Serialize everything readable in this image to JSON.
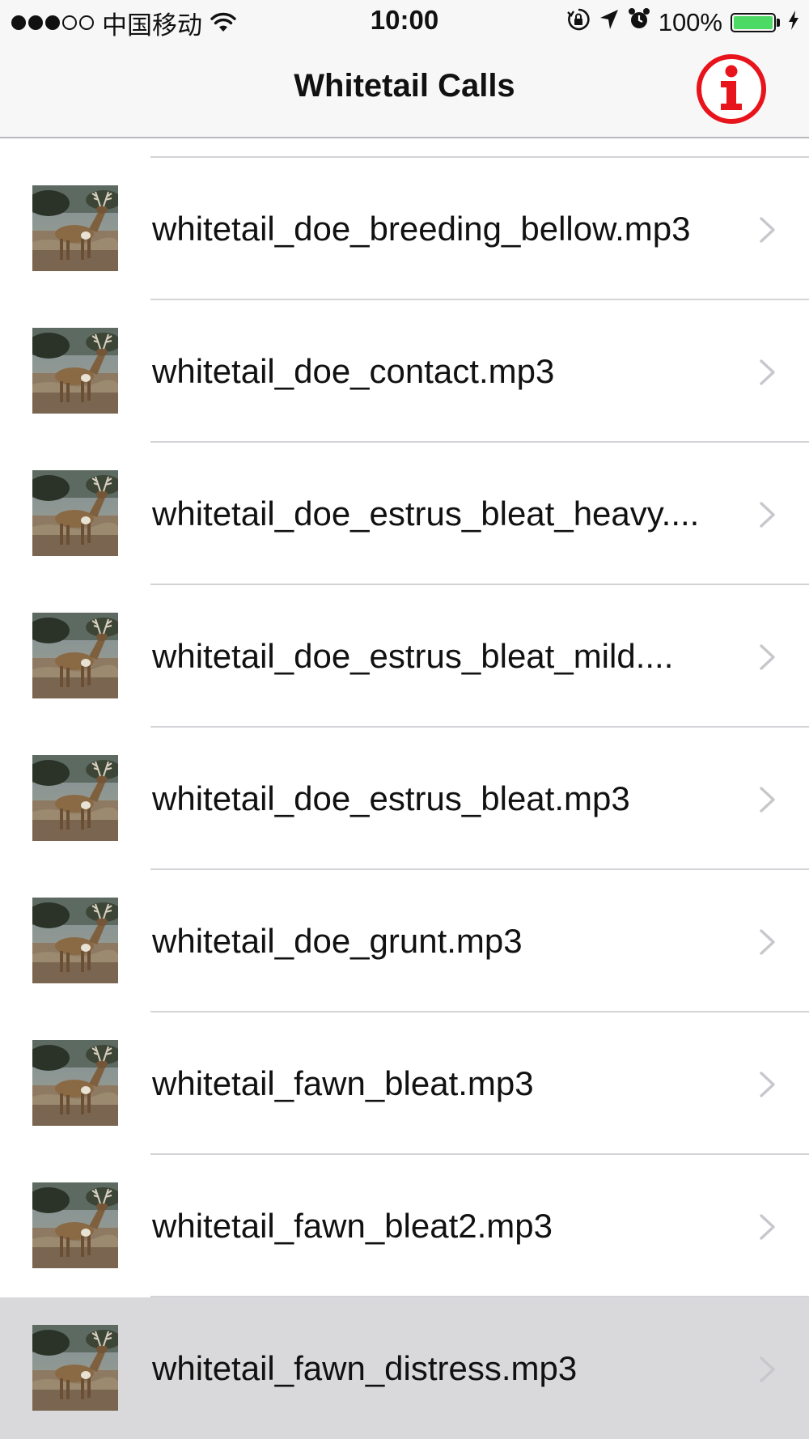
{
  "status_bar": {
    "carrier": "中国移动",
    "time": "10:00",
    "battery_label": "100%",
    "battery_level": 1.0,
    "signal_bars_filled": 3,
    "signal_bars_total": 5,
    "icons": [
      "wifi-icon",
      "orientation-lock-icon",
      "location-arrow-icon",
      "alarm-icon",
      "battery-icon",
      "charging-bolt-icon"
    ]
  },
  "nav": {
    "title": "Whitetail Calls",
    "info_icon": "info-icon",
    "info_color": "#e8141b"
  },
  "list": {
    "items": [
      {
        "label": "whitetail_doe_breeding_bellow.mp3",
        "icon": "deer-thumbnail-icon"
      },
      {
        "label": "whitetail_doe_contact.mp3",
        "icon": "deer-thumbnail-icon"
      },
      {
        "label": "whitetail_doe_estrus_bleat_heavy....",
        "icon": "deer-thumbnail-icon"
      },
      {
        "label": "whitetail_doe_estrus_bleat_mild....",
        "icon": "deer-thumbnail-icon"
      },
      {
        "label": "whitetail_doe_estrus_bleat.mp3",
        "icon": "deer-thumbnail-icon"
      },
      {
        "label": "whitetail_doe_grunt.mp3",
        "icon": "deer-thumbnail-icon"
      },
      {
        "label": "whitetail_fawn_bleat.mp3",
        "icon": "deer-thumbnail-icon"
      },
      {
        "label": "whitetail_fawn_bleat2.mp3",
        "icon": "deer-thumbnail-icon"
      },
      {
        "label": "whitetail_fawn_distress.mp3",
        "icon": "deer-thumbnail-icon",
        "highlighted": true
      }
    ],
    "chevron_icon": "chevron-right-icon"
  },
  "colors": {
    "bar_background": "#f7f7f8",
    "highlight_row": "#d9d9db",
    "separator": "#d4d4d8",
    "chevron": "#c7c7cc",
    "battery_fill": "#4cd964"
  }
}
